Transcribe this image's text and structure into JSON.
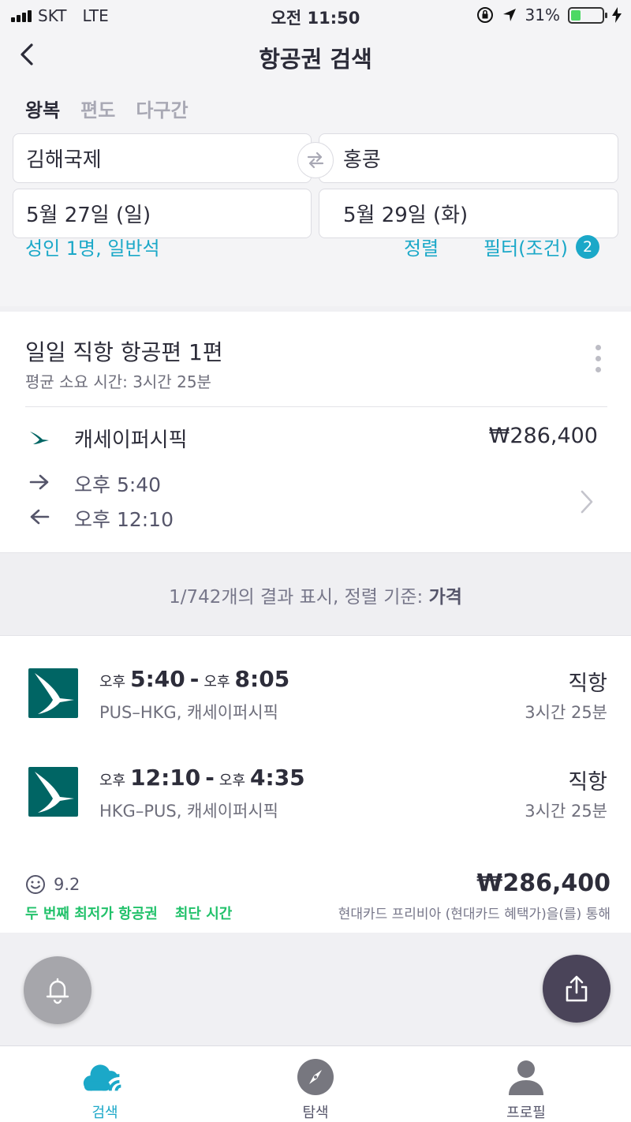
{
  "status_bar": {
    "carrier": "SKT",
    "network": "LTE",
    "time": "오전 11:50",
    "battery": "31%",
    "battery_level": 0.31
  },
  "header": {
    "title": "항공권 검색",
    "trip_types": [
      "왕복",
      "편도",
      "다구간"
    ],
    "active_trip_type": "왕복",
    "origin": "김해국제",
    "destination": "홍콩",
    "depart_date": "5월 27일 (일)",
    "return_date": "5월 29일 (화)",
    "passengers": "성인 1명, 일반석",
    "sort_label": "정렬",
    "filter_label": "필터(조건)",
    "filter_count": "2"
  },
  "direct_card": {
    "title": "일일 직항 항공편 1편",
    "subtitle": "평균 소요 시간: 3시간 25분",
    "airline": "캐세이퍼시픽",
    "price": "₩286,400",
    "outbound_time": "오후 5:40",
    "return_time": "오후 12:10"
  },
  "results_summary": {
    "text": "1/742개의 결과 표시, 정렬 기준: ",
    "sort_value": "가격"
  },
  "result_card": {
    "legs": [
      {
        "dep_period": "오후",
        "dep_time": "5:40",
        "arr_period": "오후",
        "arr_time": "8:05",
        "route": "PUS–HKG, 캐세이퍼시픽",
        "type": "직항",
        "duration": "3시간 25분"
      },
      {
        "dep_period": "오후",
        "dep_time": "12:10",
        "arr_period": "오후",
        "arr_time": "4:35",
        "route": "HKG–PUS, 캐세이퍼시픽",
        "type": "직항",
        "duration": "3시간 25분"
      }
    ],
    "rating": "9.2",
    "tags": [
      "두 번째 최저가 항공권",
      "최단 시간"
    ],
    "price": "₩286,400",
    "price_note": "현대카드 프리비아 (현대카드 혜택가)을(를) 통해"
  },
  "bottom_nav": {
    "items": [
      {
        "label": "검색",
        "icon": "search-cloud-icon"
      },
      {
        "label": "탐색",
        "icon": "compass-icon"
      },
      {
        "label": "프로필",
        "icon": "profile-icon"
      }
    ]
  },
  "colors": {
    "accent": "#1ba8c8",
    "tag_green": "#21c16a",
    "airline_teal": "#006564",
    "share_button": "#4a4459"
  }
}
